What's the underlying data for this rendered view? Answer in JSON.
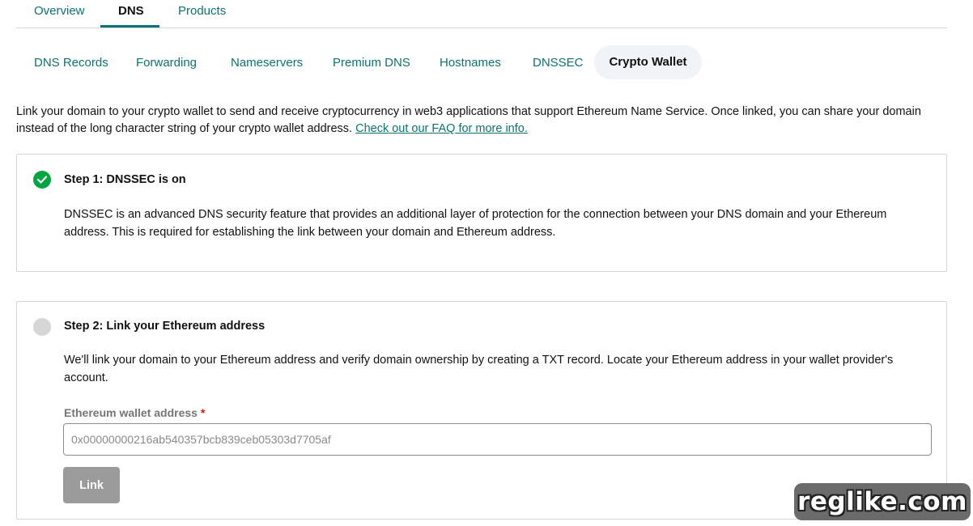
{
  "top_tabs": [
    {
      "label": "Overview"
    },
    {
      "label": "DNS",
      "active": true
    },
    {
      "label": "Products"
    }
  ],
  "sub_tabs": [
    {
      "label": "DNS Records"
    },
    {
      "label": "Forwarding"
    },
    {
      "label": "Nameservers"
    },
    {
      "label": "Premium DNS"
    },
    {
      "label": "Hostnames"
    },
    {
      "label": "DNSSEC"
    },
    {
      "label": "Crypto Wallet",
      "active": true
    }
  ],
  "intro": {
    "text": "Link your domain to your crypto wallet to send and receive cryptocurrency in web3 applications that support Ethereum Name Service. Once linked, you can share your domain instead of the long character string of your crypto wallet address.",
    "link": "Check out our FAQ for more info."
  },
  "step1": {
    "title": "Step 1: DNSSEC is on",
    "body": "DNSSEC is an advanced DNS security feature that provides an additional layer of protection for the connection between your DNS domain and your Ethereum address. This is required for establishing the link between your domain and Ethereum address.",
    "status_icon": "check-circle-icon",
    "status_color": "#00a63f"
  },
  "step2": {
    "title": "Step 2: Link your Ethereum address",
    "body": "We'll link your domain to your Ethereum address and verify domain ownership by creating a TXT record. Locate your Ethereum address in your wallet provider's account.",
    "status_icon": "pending-circle-icon",
    "field_label": "Ethereum wallet address",
    "required_mark": "*",
    "input_value": "",
    "input_placeholder": "0x00000000216ab540357bcb839ceb05303d7705af",
    "button_label": "Link"
  },
  "colors": {
    "accent": "#0b7372",
    "success": "#00a63f",
    "disabled_button": "#9b9b9b"
  },
  "watermark": "reglike.com"
}
